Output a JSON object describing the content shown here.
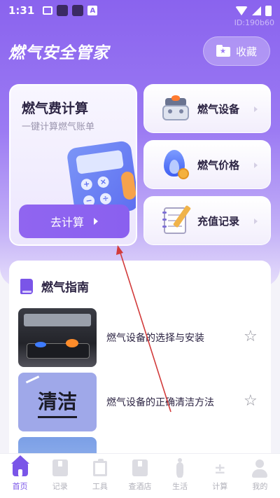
{
  "status_bar": {
    "time": "1:31",
    "watermark": "ID:190b60"
  },
  "header": {
    "title": "燃气安全管家",
    "favorite_label": "收藏"
  },
  "calc_card": {
    "title": "燃气费计算",
    "subtitle": "一键计算燃气账单",
    "button_label": "去计算"
  },
  "side_cards": [
    {
      "label": "燃气设备",
      "icon": "gas-stove-icon"
    },
    {
      "label": "燃气价格",
      "icon": "gas-flame-price-icon"
    },
    {
      "label": "充值记录",
      "icon": "notebook-record-icon"
    }
  ],
  "guide": {
    "title": "燃气指南",
    "items": [
      {
        "text": "燃气设备的选择与安装",
        "thumb": "gas-stove-photo"
      },
      {
        "text": "燃气设备的正确清洁方法",
        "thumb_text": "清洁"
      },
      {
        "text": "",
        "thumb": "blue-pattern"
      }
    ]
  },
  "tabs": [
    {
      "label": "首页",
      "active": true
    },
    {
      "label": "记录"
    },
    {
      "label": "工具"
    },
    {
      "label": "查酒店"
    },
    {
      "label": "生活"
    },
    {
      "label": "计算"
    },
    {
      "label": "我的"
    }
  ],
  "colors": {
    "accent": "#7a55e8",
    "hero_top": "#8a63ee",
    "inactive_tab": "#b1b1ba"
  }
}
